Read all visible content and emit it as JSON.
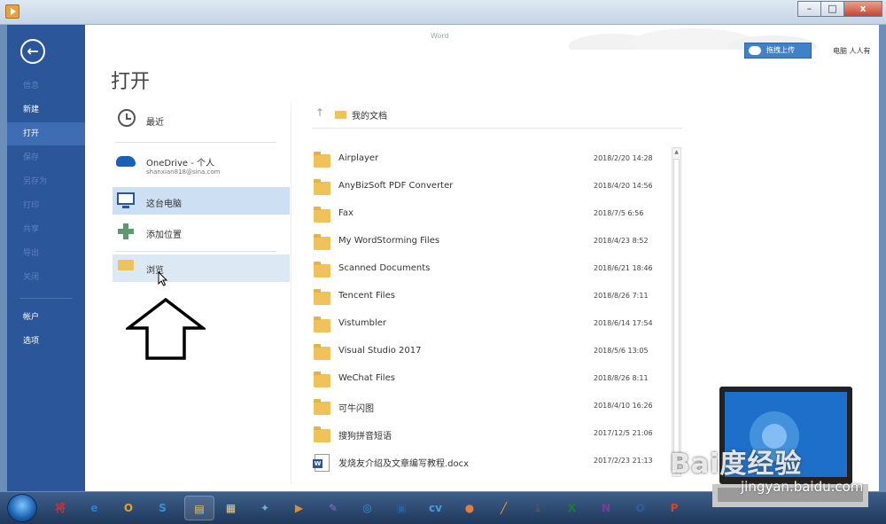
{
  "window": {
    "app_label": "Word",
    "controls": {
      "minimize": "–",
      "maximize": "□",
      "close": "x"
    }
  },
  "header": {
    "upload_button": "拖拽上传",
    "user_name": "电脑 人人有"
  },
  "nav": {
    "back_glyph": "←",
    "items": [
      {
        "label": "信息",
        "state": "dim"
      },
      {
        "label": "新建",
        "state": "normal"
      },
      {
        "label": "打开",
        "state": "active"
      },
      {
        "label": "保存",
        "state": "dim"
      },
      {
        "label": "另存为",
        "state": "dim"
      },
      {
        "label": "打印",
        "state": "dim"
      },
      {
        "label": "共享",
        "state": "dim"
      },
      {
        "label": "导出",
        "state": "dim"
      },
      {
        "label": "关闭",
        "state": "dim"
      },
      {
        "label": "帐户",
        "state": "normal"
      },
      {
        "label": "选项",
        "state": "normal"
      }
    ]
  },
  "main": {
    "title": "打开",
    "places": {
      "recent": "最近",
      "onedrive": "OneDrive - 个人",
      "onedrive_email": "shanxian818@sina.com",
      "this_pc": "这台电脑",
      "add_place": "添加位置",
      "browse": "浏览"
    },
    "breadcrumb": {
      "up_glyph": "↑",
      "folder": "我的文档"
    },
    "files": [
      {
        "name": "Airplayer",
        "date": "2018/2/20 14:28",
        "type": "folder"
      },
      {
        "name": "AnyBizSoft PDF Converter",
        "date": "2018/4/20 14:56",
        "type": "folder"
      },
      {
        "name": "Fax",
        "date": "2018/7/5 6:56",
        "type": "folder"
      },
      {
        "name": "My WordStorming Files",
        "date": "2018/4/23 8:52",
        "type": "folder"
      },
      {
        "name": "Scanned Documents",
        "date": "2018/6/21 18:46",
        "type": "folder"
      },
      {
        "name": "Tencent Files",
        "date": "2018/8/26 7:11",
        "type": "folder"
      },
      {
        "name": "Vistumbler",
        "date": "2018/6/14 17:54",
        "type": "folder"
      },
      {
        "name": "Visual Studio 2017",
        "date": "2018/5/6 13:05",
        "type": "folder"
      },
      {
        "name": "WeChat Files",
        "date": "2018/8/26 8:11",
        "type": "folder"
      },
      {
        "name": "可牛闪图",
        "date": "2018/4/10 16:26",
        "type": "folder"
      },
      {
        "name": "搜狗拼音短语",
        "date": "2017/12/5 21:06",
        "type": "folder"
      },
      {
        "name": "发烧友介绍及文章编写教程.docx",
        "date": "2017/2/23 21:13",
        "type": "docx"
      }
    ]
  },
  "taskbar": {
    "items": [
      "将",
      "e",
      "O",
      "S",
      "▤",
      "▦",
      "✦",
      "▶",
      "✎",
      "◎",
      "▣",
      "cv",
      "●",
      "╱",
      "♝",
      "X",
      "N",
      "O",
      "P"
    ]
  },
  "watermark": {
    "logo": "Bai度经验",
    "url": "jingyan.baidu.com"
  },
  "colors": {
    "nav_bg": "#2b579a",
    "nav_active": "#3e6db3",
    "selection": "#cddff3",
    "folder": "#f0c25c"
  }
}
